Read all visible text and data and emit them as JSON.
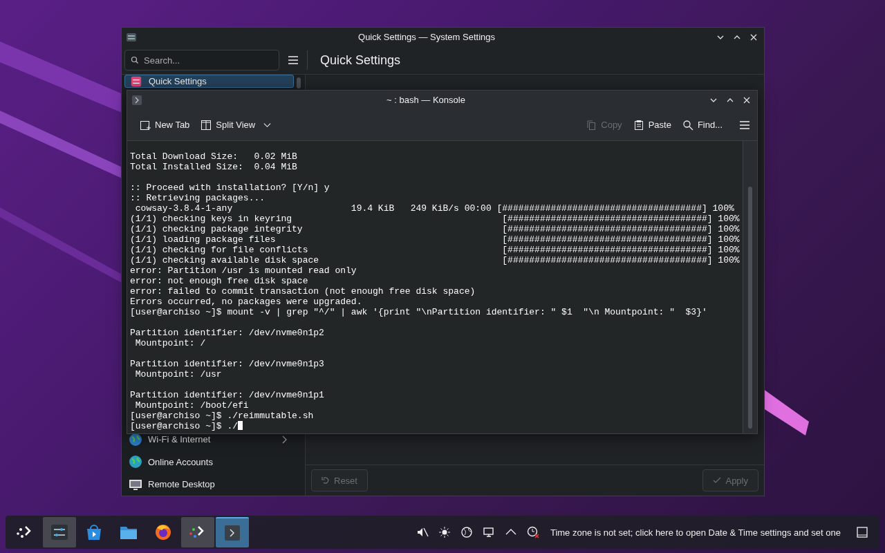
{
  "settings_window": {
    "title": "Quick Settings — System Settings",
    "search": {
      "placeholder": "Search..."
    },
    "page_title": "Quick Settings",
    "sidebar": {
      "items": [
        {
          "label": "Quick Settings",
          "kind": "quick",
          "selected": true,
          "has_children": false
        },
        {
          "label": "Wi-Fi & Internet",
          "kind": "globe",
          "selected": false,
          "has_children": true
        },
        {
          "label": "Online Accounts",
          "kind": "accounts",
          "selected": false,
          "has_children": false
        },
        {
          "label": "Remote Desktop",
          "kind": "remote",
          "selected": false,
          "has_children": false
        }
      ]
    },
    "footer": {
      "reset": {
        "label": "Reset",
        "disabled": true
      },
      "apply": {
        "label": "Apply",
        "disabled": true
      }
    }
  },
  "konsole": {
    "title": "~ : bash — Konsole",
    "toolbar": [
      {
        "label": "New Tab",
        "kind": "new-tab",
        "disabled": false,
        "dropdown": false
      },
      {
        "label": "Split View",
        "kind": "split",
        "disabled": false,
        "dropdown": true
      },
      {
        "label": "Copy",
        "kind": "copy",
        "disabled": true,
        "dropdown": false
      },
      {
        "label": "Paste",
        "kind": "paste",
        "disabled": false,
        "dropdown": false
      },
      {
        "label": "Find...",
        "kind": "find",
        "disabled": false,
        "dropdown": false
      }
    ],
    "cursor": true,
    "blocks": [
      {
        "lines": [
          "Total Download Size:   0.02 MiB",
          "Total Installed Size:  0.04 MiB"
        ]
      },
      {
        "lines": [
          ":: Proceed with installation? [Y/n] y",
          ":: Retrieving packages...",
          " cowsay-3.8.4-1-any                      19.4 KiB   249 KiB/s 00:00 [#####################################] 100%",
          "(1/1) checking keys in keyring                                       [#####################################] 100%",
          "(1/1) checking package integrity                                     [#####################################] 100%",
          "(1/1) loading package files                                          [#####################################] 100%",
          "(1/1) checking for file conflicts                                    [#####################################] 100%",
          "(1/1) checking available disk space                                  [#####################################] 100%",
          "error: Partition /usr is mounted read only",
          "error: not enough free disk space",
          "error: failed to commit transaction (not enough free disk space)",
          "Errors occurred, no packages were upgraded.",
          "[user@archiso ~]$ mount -v | grep \"^/\" | awk '{print \"\\nPartition identifier: \" $1  \"\\n Mountpoint: \"  $3}'"
        ]
      },
      {
        "lines": [
          "Partition identifier: /dev/nvme0n1p2",
          " Mountpoint: /"
        ]
      },
      {
        "lines": [
          "Partition identifier: /dev/nvme0n1p3",
          " Mountpoint: /usr"
        ]
      },
      {
        "lines": [
          "Partition identifier: /dev/nvme0n1p1",
          " Mountpoint: /boot/efi",
          "[user@archiso ~]$ ./reimmutable.sh",
          "[user@archiso ~]$ ./"
        ]
      }
    ]
  },
  "taskbar": {
    "tasks": [
      {
        "kind": "launcher",
        "open": false,
        "selected": false
      },
      {
        "kind": "settings",
        "open": true,
        "selected": false
      },
      {
        "kind": "store",
        "open": false,
        "selected": false
      },
      {
        "kind": "folder",
        "open": false,
        "selected": false
      },
      {
        "kind": "browser",
        "open": false,
        "selected": false
      },
      {
        "kind": "launcher2",
        "open": true,
        "selected": false
      },
      {
        "kind": "terminal",
        "open": true,
        "selected": true
      }
    ],
    "tray": [
      {
        "kind": "muted"
      },
      {
        "kind": "brightness"
      },
      {
        "kind": "network"
      },
      {
        "kind": "display"
      },
      {
        "kind": "expand"
      },
      {
        "kind": "clock-alert"
      }
    ],
    "notice": "Time zone is not set; click here to open Date & Time settings and set one"
  }
}
